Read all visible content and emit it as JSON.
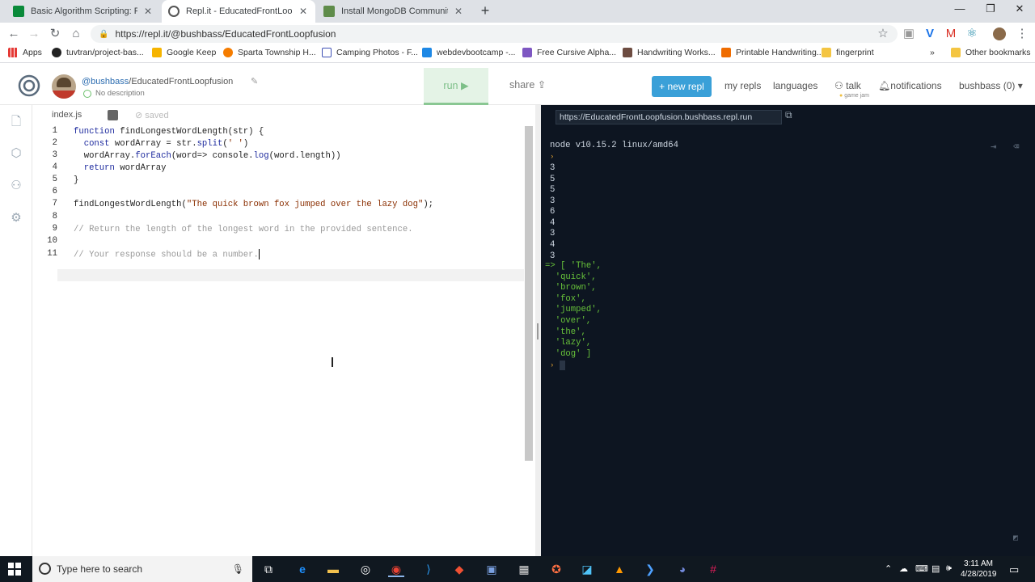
{
  "browser": {
    "tabs": [
      {
        "title": "Basic Algorithm Scripting: Find th",
        "active": false
      },
      {
        "title": "Repl.it - EducatedFrontLoopfusio",
        "active": true
      },
      {
        "title": "Install MongoDB Community Edi",
        "active": false
      }
    ],
    "address": "https://repl.it/@bushbass/EducatedFrontLoopfusion",
    "bookmarks": [
      "Apps",
      "tuvtran/project-bas...",
      "Google Keep",
      "Sparta Township H...",
      "Camping Photos - F...",
      "webdevbootcamp -...",
      "Free Cursive Alpha...",
      "Handwriting Works...",
      "Printable Handwriting...",
      "fingerprint"
    ],
    "other_bookmarks": "Other bookmarks"
  },
  "repl": {
    "user": "@bushbass",
    "repl_name": "/EducatedFrontLoopfusion",
    "description": "No description",
    "run_label": "run",
    "share_label": "share",
    "new_repl_label": "+ new repl",
    "nav": {
      "my_repls": "my repls",
      "languages": "languages",
      "talk": "talk",
      "game_jam": "game jam",
      "notifications": "notifications",
      "user_menu": "bushbass (0)"
    }
  },
  "editor": {
    "filename": "index.js",
    "status": "saved",
    "line_numbers": [
      "1",
      "2",
      "3",
      "4",
      "5",
      "6",
      "7",
      "8",
      "9",
      "10",
      "11"
    ],
    "lines": {
      "l1a": "function ",
      "l1b": "findLongestWordLength(str) {",
      "l2a": "  const ",
      "l2b": "wordArray = str.",
      "l2c": "split",
      "l2d": "(",
      "l2e": "' '",
      "l2f": ")",
      "l3a": "  wordArray.",
      "l3b": "forEach",
      "l3c": "(word=> console.",
      "l3d": "log",
      "l3e": "(word.length))",
      "l4a": "  return ",
      "l4b": "wordArray",
      "l5": "}",
      "l7a": "findLongestWordLength(",
      "l7b": "\"The quick brown fox jumped over the lazy dog\"",
      "l7c": ");",
      "l9": "// Return the length of the longest word in the provided sentence.",
      "l11": "// Your response should be a number."
    }
  },
  "console": {
    "url": "https://EducatedFrontLoopfusion.bushbass.repl.run",
    "header": "node v10.15.2 linux/amd64",
    "outputs": [
      "3",
      "5",
      "5",
      "3",
      "6",
      "4",
      "3",
      "4",
      "3"
    ],
    "result": "=> [ 'The',\n  'quick',\n  'brown',\n  'fox',\n  'jumped',\n  'over',\n  'the',\n  'lazy',\n  'dog' ]"
  },
  "taskbar": {
    "search_placeholder": "Type here to search",
    "time": "3:11 AM",
    "date": "4/28/2019"
  }
}
